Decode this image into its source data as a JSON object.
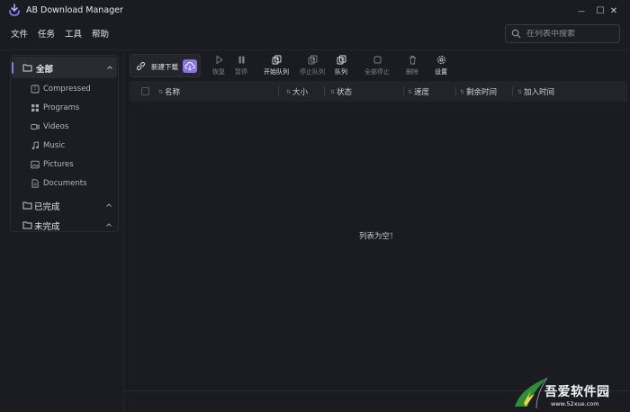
{
  "window": {
    "title": "AB Download Manager",
    "controls": {
      "minimize": "—",
      "maximize": "☐",
      "close": "✕"
    }
  },
  "menu": [
    "文件",
    "任务",
    "工具",
    "帮助"
  ],
  "search": {
    "placeholder": "在列表中搜索",
    "value": ""
  },
  "sidebar": {
    "all_label": "全部",
    "categories": [
      "Compressed",
      "Programs",
      "Videos",
      "Music",
      "Pictures",
      "Documents"
    ],
    "completed_label": "已完成",
    "unfinished_label": "未完成"
  },
  "toolbar": {
    "new_download": "新建下载",
    "resume": "恢复",
    "pause": "暂停",
    "start_queue": "开始队列",
    "stop_queue": "停止队列",
    "queue": "队列",
    "stop_all": "全部停止",
    "delete": "删除",
    "settings": "设置"
  },
  "table": {
    "columns": [
      "名称",
      "大小",
      "状态",
      "速度",
      "剩余时间",
      "加入时间"
    ],
    "empty_message": "列表为空！"
  },
  "watermark": {
    "text": "吾爱软件园",
    "url": "www.52xue.com"
  },
  "colors": {
    "background": "#1b1c21",
    "accent": "#8b73e6",
    "panel": "#23242a"
  }
}
